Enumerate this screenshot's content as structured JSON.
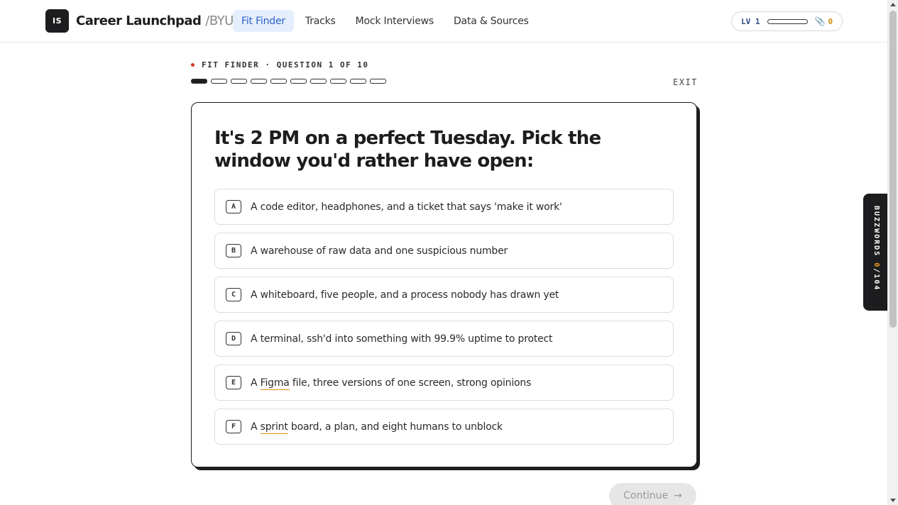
{
  "header": {
    "logo": "IS",
    "brand": "Career Launchpad",
    "brand_separator": "/",
    "brand_org": "BYU",
    "nav": [
      {
        "label": "Fit Finder",
        "active": true
      },
      {
        "label": "Tracks",
        "active": false
      },
      {
        "label": "Mock Interviews",
        "active": false
      },
      {
        "label": "Data & Sources",
        "active": false
      }
    ],
    "level_label": "LV 1",
    "level_progress": 0,
    "clips_icon": "paperclip-icon",
    "clips_count": "0"
  },
  "quiz": {
    "eyebrow": "FIT FINDER · QUESTION 1 OF 10",
    "current": 1,
    "total": 10,
    "exit_label": "EXIT",
    "question": "It's 2 PM on a perfect Tuesday. Pick the window you'd rather have open:",
    "options": [
      {
        "key": "A",
        "pre": "A code editor, headphones, and a ticket that says 'make it work'",
        "term": "",
        "post": ""
      },
      {
        "key": "B",
        "pre": "A warehouse of raw data and one suspicious number",
        "term": "",
        "post": ""
      },
      {
        "key": "C",
        "pre": "A whiteboard, five people, and a process nobody has drawn yet",
        "term": "",
        "post": ""
      },
      {
        "key": "D",
        "pre": "A terminal, ssh'd into something with 99.9% uptime to protect",
        "term": "",
        "post": ""
      },
      {
        "key": "E",
        "pre": "A ",
        "term": "Figma",
        "post": " file, three versions of one screen, strong opinions"
      },
      {
        "key": "F",
        "pre": "A ",
        "term": "sprint",
        "post": " board, a plan, and eight humans to unblock"
      }
    ],
    "continue_label": "Continue",
    "continue_icon": "arrow-right-icon"
  },
  "buzzwords": {
    "label": "BUZZWORDS",
    "found": "0",
    "total": "/104"
  },
  "colors": {
    "accent_blue": "#2c62c9",
    "active_nav_bg": "#e4eefc",
    "buzz_underline": "#e08a1a",
    "dot_red": "#d03a2f"
  }
}
